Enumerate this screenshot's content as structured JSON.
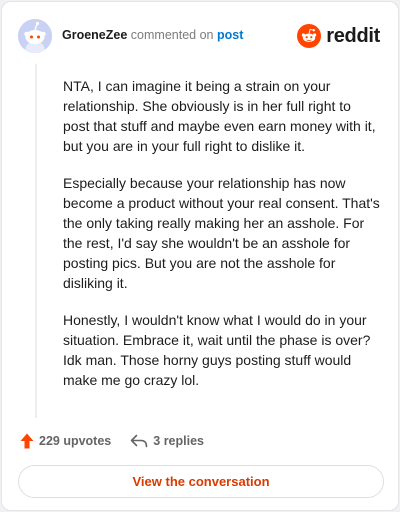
{
  "header": {
    "username": "GroeneZee",
    "action_text": "commented on",
    "post_link": "post",
    "avatar_icon": "snoo-avatar-icon",
    "brand_icon": "reddit-logo-icon",
    "brand_text": "reddit"
  },
  "comment": {
    "paragraphs": [
      "NTA, I can imagine it being a strain on your relationship. She obviously is in her full right to post that stuff and maybe even earn money with it, but you are in your full right to dislike it.",
      "Especially because your relationship has now become a product without your real consent. That's the only taking really making her an asshole. For the rest, I'd say she wouldn't be an asshole for posting pics. But you are not the asshole for disliking it.",
      "Honestly, I wouldn't know what I would do in your situation. Embrace it, wait until the phase is over? Idk man. Those horny guys posting stuff would make me go crazy lol."
    ]
  },
  "actions": {
    "upvotes_label": "229 upvotes",
    "upvote_icon": "upvote-arrow-icon",
    "replies_label": "3 replies",
    "reply_icon": "reply-arrow-icon"
  },
  "footer": {
    "button_label": "View the conversation"
  },
  "colors": {
    "brand_orange": "#ff4500",
    "link_blue": "#0079d3",
    "button_text": "#d93a00"
  }
}
